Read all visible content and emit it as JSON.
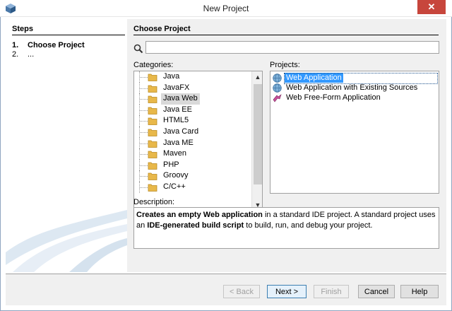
{
  "window": {
    "title": "New Project",
    "close_glyph": "✕",
    "app_icon": "netbeans-cube-icon"
  },
  "steps": {
    "header": "Steps",
    "items": [
      {
        "num": "1.",
        "label": "Choose Project",
        "active": true
      },
      {
        "num": "2.",
        "label": "...",
        "active": false
      }
    ]
  },
  "main": {
    "header": "Choose Project",
    "search": {
      "value": "",
      "placeholder": ""
    },
    "categories_label": "Categories:",
    "projects_label": "Projects:",
    "description_label": "Description:",
    "categories": [
      {
        "label": "Java",
        "selected": false
      },
      {
        "label": "JavaFX",
        "selected": false
      },
      {
        "label": "Java Web",
        "selected": true
      },
      {
        "label": "Java EE",
        "selected": false
      },
      {
        "label": "HTML5",
        "selected": false
      },
      {
        "label": "Java Card",
        "selected": false
      },
      {
        "label": "Java ME",
        "selected": false
      },
      {
        "label": "Maven",
        "selected": false
      },
      {
        "label": "PHP",
        "selected": false
      },
      {
        "label": "Groovy",
        "selected": false
      },
      {
        "label": "C/C++",
        "selected": false
      }
    ],
    "projects": [
      {
        "label": "Web Application",
        "icon": "globe-icon",
        "selected": true
      },
      {
        "label": "Web Application with Existing Sources",
        "icon": "globe-icon",
        "selected": false
      },
      {
        "label": "Web Free-Form Application",
        "icon": "freeform-icon",
        "selected": false
      }
    ],
    "description": {
      "bold1": "Creates an empty Web application",
      "text1": " in a standard IDE project. A standard project uses an ",
      "bold2": "IDE-generated build script",
      "text2": " to build, run, and debug your project."
    }
  },
  "buttons": {
    "back": "< Back",
    "next": "Next >",
    "finish": "Finish",
    "cancel": "Cancel",
    "help": "Help"
  },
  "colors": {
    "selection": "#3399ff",
    "close_button": "#c7463c",
    "folder": "#e8b84a"
  }
}
